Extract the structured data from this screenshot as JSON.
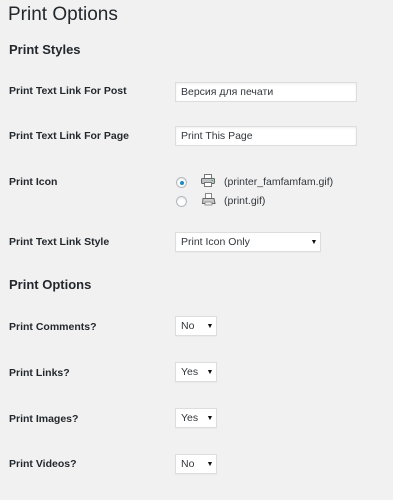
{
  "page_title": "Print Options",
  "sections": {
    "print_styles": "Print Styles",
    "print_options": "Print Options"
  },
  "rows": {
    "post_link_label": "Print Text Link For Post",
    "post_link_value": "Версия для печати",
    "page_link_label": "Print Text Link For Page",
    "page_link_value": "Print This Page",
    "icon_label": "Print Icon",
    "icon_options": [
      {
        "name": "(printer_famfamfam.gif)",
        "selected": true,
        "icon": "printer-icon"
      },
      {
        "name": "(print.gif)",
        "selected": false,
        "icon": "print-gif-icon"
      }
    ],
    "link_style_label": "Print Text Link Style",
    "link_style_value": "Print Icon Only",
    "comments_label": "Print Comments?",
    "comments_value": "No",
    "links_label": "Print Links?",
    "links_value": "Yes",
    "images_label": "Print Images?",
    "images_value": "Yes",
    "videos_label": "Print Videos?",
    "videos_value": "No"
  },
  "colors": {
    "background": "#f1f1f1",
    "radio_selected": "#1e8cbe",
    "heading": "#23282d"
  }
}
